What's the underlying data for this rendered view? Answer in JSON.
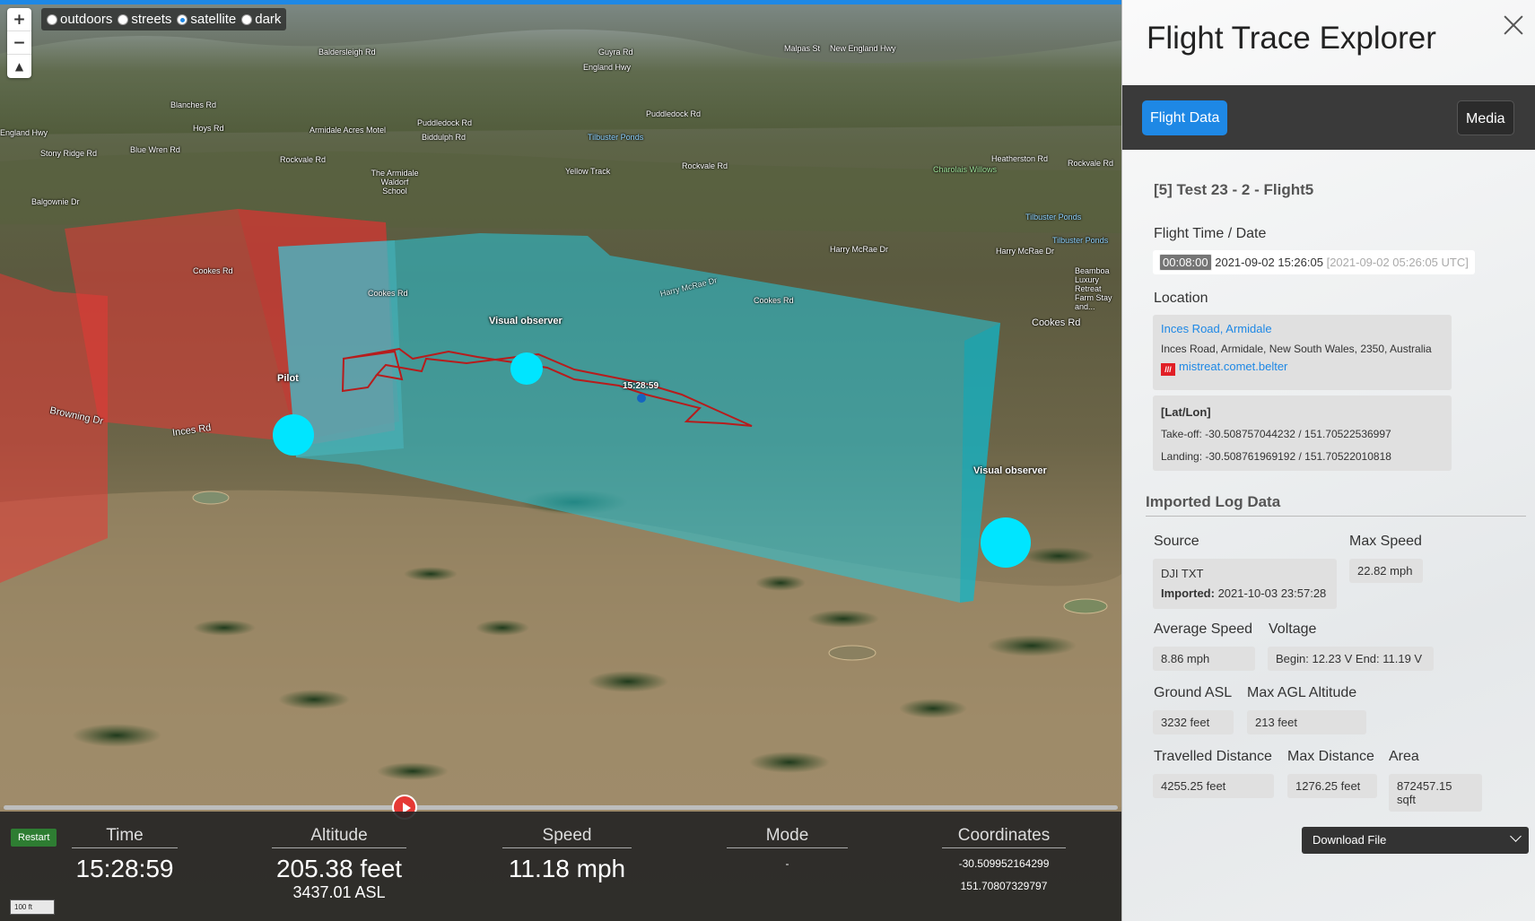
{
  "map": {
    "style_options": [
      {
        "label": "outdoors",
        "selected": false
      },
      {
        "label": "streets",
        "selected": false
      },
      {
        "label": "satellite",
        "selected": true
      },
      {
        "label": "dark",
        "selected": false
      }
    ],
    "zoom_in_label": "+",
    "zoom_out_label": "−",
    "compass_label": "▲",
    "road_labels": [
      "Baldersleigh Rd",
      "Guyra Rd",
      "Malpas St",
      "New England Hwy",
      "New England Hwy",
      "Blanches Rd",
      "Hoys Rd",
      "Armidale Acres Motel",
      "Puddledock Rd",
      "Puddledock Rd",
      "Blue Wren Rd",
      "Stony Ridge Rd",
      "Rockvale Rd",
      "The Armidale Waldorf School",
      "Rockvale Rd",
      "Yellow Track",
      "Tilbuster Ponds",
      "Heatherston Rd",
      "Rockvale Rd",
      "Charolais Willows",
      "Balgownie Dr",
      "England Hwy",
      "Biddulph Rd",
      "Tilbuster Ponds",
      "Tilbuster Ponds",
      "Harry McRae Dr",
      "Harry McRae Dr",
      "Beamboa Luxury Retreat Farm Stay and...",
      "Cookes Rd",
      "Cookes Rd",
      "Cookes Rd",
      "Cookes Rd",
      "Harry McRae Dr",
      "Browning Dr",
      "Inces Rd"
    ],
    "markers": {
      "pilot": "Pilot",
      "observer_1": "Visual observer",
      "observer_2": "Visual observer",
      "current_time": "15:28:59"
    },
    "colors": {
      "restricted_zone": "#e53935",
      "flight_volume": "#26c6da",
      "marker": "#00e5ff",
      "track": "#b71c1c"
    }
  },
  "playback": {
    "progress_fraction": 0.36,
    "restart_label": "Restart",
    "scale_label": "100 ft",
    "stats": {
      "time": {
        "head": "Time",
        "value": "15:28:59"
      },
      "altitude": {
        "head": "Altitude",
        "value": "205.38 feet",
        "sub": "3437.01 ASL"
      },
      "speed": {
        "head": "Speed",
        "value": "11.18 mph"
      },
      "mode": {
        "head": "Mode",
        "value": "-"
      },
      "coordinates": {
        "head": "Coordinates",
        "lat": "-30.509952164299",
        "lon": "151.70807329797"
      }
    }
  },
  "sidebar": {
    "title": "Flight Trace Explorer",
    "tabs": {
      "flight_data": "Flight Data",
      "media": "Media"
    },
    "flight_name": "[5] Test 23 - 2 - Flight5",
    "flight_time_label": "Flight Time / Date",
    "flight_duration": "00:08:00",
    "flight_date_local": "2021-09-02 15:26:05",
    "flight_date_utc": "[2021-09-02 05:26:05 UTC]",
    "location_label": "Location",
    "location_link": "Inces Road, Armidale",
    "location_full": "Inces Road, Armidale, New South Wales, 2350, Australia",
    "what3words_icon": "///",
    "what3words": "mistreat.comet.belter",
    "latlon_label": "[Lat/Lon]",
    "takeoff_label": "Take-off:",
    "takeoff_value": "-30.508757044232 / 151.70522536997",
    "landing_label": "Landing:",
    "landing_value": "-30.508761969192 / 151.70522010818",
    "imported_title": "Imported Log Data",
    "source_label": "Source",
    "source_value": "DJI TXT",
    "imported_label": "Imported:",
    "imported_value": "2021-10-03 23:57:28",
    "max_speed_label": "Max Speed",
    "max_speed_value": "22.82 mph",
    "avg_speed_label": "Average Speed",
    "avg_speed_value": "8.86 mph",
    "voltage_label": "Voltage",
    "voltage_value": "Begin: 12.23 V End: 11.19 V",
    "ground_asl_label": "Ground ASL",
    "ground_asl_value": "3232 feet",
    "max_agl_label": "Max AGL Altitude",
    "max_agl_value": "213 feet",
    "travelled_label": "Travelled Distance",
    "travelled_value": "4255.25 feet",
    "max_distance_label": "Max Distance",
    "max_distance_value": "1276.25 feet",
    "area_label": "Area",
    "area_value": "872457.15 sqft",
    "download_label": "Download File"
  }
}
